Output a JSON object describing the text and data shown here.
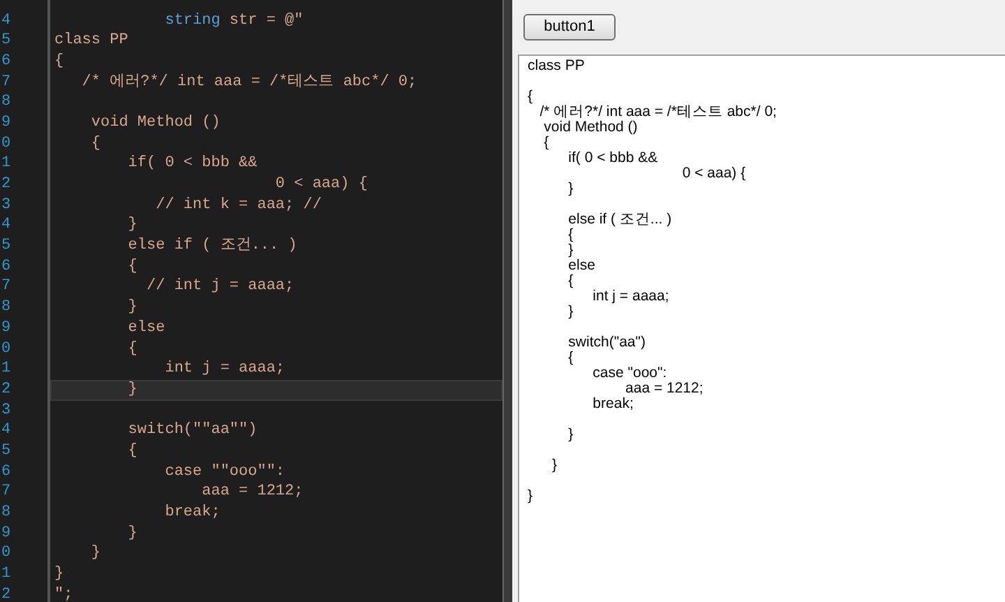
{
  "editor": {
    "lines": [
      {
        "number": "4",
        "current": false,
        "parts": [
          {
            "text": "            string",
            "kind": "keyword"
          },
          {
            "text": " str = @\"",
            "kind": "plain"
          }
        ]
      },
      {
        "number": "5",
        "current": false,
        "text": "class PP"
      },
      {
        "number": "6",
        "current": false,
        "text": "{"
      },
      {
        "number": "7",
        "current": false,
        "text": "   /* 에러?*/ int aaa = /*테스트 abc*/ 0;"
      },
      {
        "number": "8",
        "current": false
      },
      {
        "number": "9",
        "current": false,
        "text": "    void Method ()"
      },
      {
        "number": "0",
        "current": false,
        "text": "    {"
      },
      {
        "number": "1",
        "current": false,
        "text": "        if( 0 < bbb &&"
      },
      {
        "number": "2",
        "current": false,
        "text": "                        0 < aaa) {"
      },
      {
        "number": "3",
        "current": false,
        "text": "           // int k = aaa; //"
      },
      {
        "number": "4",
        "current": false,
        "text": "        }"
      },
      {
        "number": "5",
        "current": false,
        "text": "        else if ( 조건... )"
      },
      {
        "number": "6",
        "current": false,
        "text": "        {"
      },
      {
        "number": "7",
        "current": false,
        "text": "          // int j = aaaa;"
      },
      {
        "number": "8",
        "current": false,
        "text": "        }"
      },
      {
        "number": "9",
        "current": false,
        "text": "        else"
      },
      {
        "number": "0",
        "current": false,
        "text": "        {"
      },
      {
        "number": "1",
        "current": false,
        "text": "            int j = aaaa;"
      },
      {
        "number": "2",
        "current": true,
        "text": "        }"
      },
      {
        "number": "3",
        "current": false
      },
      {
        "number": "4",
        "current": false,
        "text": "        switch(\"\"aa\"\")"
      },
      {
        "number": "5",
        "current": false,
        "text": "        {"
      },
      {
        "number": "6",
        "current": false,
        "text": "            case \"\"ooo\"\":"
      },
      {
        "number": "7",
        "current": false,
        "text": "                aaa = 1212;"
      },
      {
        "number": "8",
        "current": false,
        "text": "            break;"
      },
      {
        "number": "9",
        "current": false,
        "text": "        }"
      },
      {
        "number": "0",
        "current": false,
        "text": "    }"
      },
      {
        "number": "1",
        "current": false,
        "text": "}"
      },
      {
        "number": "2",
        "current": false,
        "text": "\";"
      }
    ]
  },
  "form": {
    "button": "button1",
    "output_lines": [
      {
        "kind": "text",
        "text": "class PP"
      },
      {
        "kind": "blank"
      },
      {
        "kind": "text",
        "text": "{"
      },
      {
        "kind": "text",
        "text": "   /* 에러?*/ int aaa = /*테스트 abc*/ 0;"
      },
      {
        "kind": "text",
        "text": "    void Method ()"
      },
      {
        "kind": "text",
        "text": "    {"
      },
      {
        "kind": "text",
        "text": "          if( 0 < bbb &&"
      },
      {
        "kind": "text",
        "text": "                                      0 < aaa) {"
      },
      {
        "kind": "text",
        "text": "          }"
      },
      {
        "kind": "blank"
      },
      {
        "kind": "text",
        "text": "          else if ( 조건... )"
      },
      {
        "kind": "text",
        "text": "          {"
      },
      {
        "kind": "text",
        "text": "          }"
      },
      {
        "kind": "text",
        "text": "          else"
      },
      {
        "kind": "text",
        "text": "          {"
      },
      {
        "kind": "text",
        "text": "                int j = aaaa;"
      },
      {
        "kind": "text",
        "text": "          }"
      },
      {
        "kind": "blank"
      },
      {
        "kind": "text",
        "text": "          switch(\"aa\")"
      },
      {
        "kind": "text",
        "text": "          {"
      },
      {
        "kind": "text",
        "text": "                case \"ooo\":"
      },
      {
        "kind": "text",
        "text": "                        aaa = 1212;"
      },
      {
        "kind": "text",
        "text": "                break;"
      },
      {
        "kind": "blank"
      },
      {
        "kind": "text",
        "text": "          }"
      },
      {
        "kind": "blank"
      },
      {
        "kind": "text",
        "text": "      }"
      },
      {
        "kind": "blank"
      },
      {
        "kind": "text",
        "text": "}"
      }
    ]
  }
}
